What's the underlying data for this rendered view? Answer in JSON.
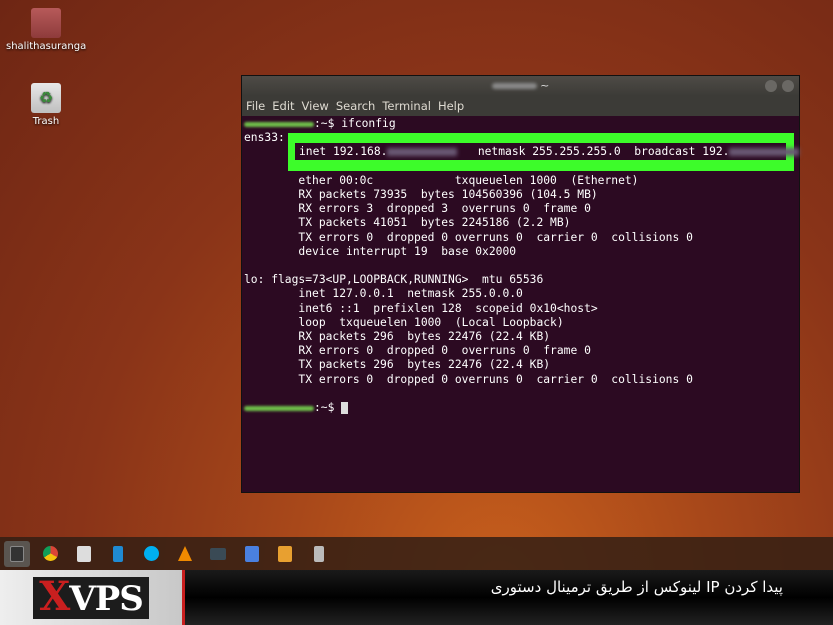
{
  "desktop": {
    "icons": [
      {
        "label": "shalithasuranga",
        "icon": "home-folder-icon"
      },
      {
        "label": "Trash",
        "icon": "trash-icon"
      }
    ]
  },
  "terminal": {
    "title_suffix": "~",
    "menu": [
      "File",
      "Edit",
      "View",
      "Search",
      "Terminal",
      "Help"
    ],
    "prompt_suffix": ":~$ ",
    "command": "ifconfig",
    "iface1": "ens33:",
    "highlight": {
      "inet": "inet 192.168.",
      "netmask": "netmask 255.255.255.0  broadcast 192.",
      "color": "#3dfc2a"
    },
    "lines1": [
      "ether 00:0c            txqueuelen 1000  (Ethernet)",
      "RX packets 73935  bytes 104560396 (104.5 MB)",
      "RX errors 3  dropped 3  overruns 0  frame 0",
      "TX packets 41051  bytes 2245186 (2.2 MB)",
      "TX errors 0  dropped 0 overruns 0  carrier 0  collisions 0",
      "device interrupt 19  base 0x2000"
    ],
    "lo_header": "lo: flags=73<UP,LOOPBACK,RUNNING>  mtu 65536",
    "lines2": [
      "inet 127.0.0.1  netmask 255.0.0.0",
      "inet6 ::1  prefixlen 128  scopeid 0x10<host>",
      "loop  txqueuelen 1000  (Local Loopback)",
      "RX packets 296  bytes 22476 (22.4 KB)",
      "RX errors 0  dropped 0  overruns 0  frame 0",
      "TX packets 296  bytes 22476 (22.4 KB)",
      "TX errors 0  dropped 0 overruns 0  carrier 0  collisions 0"
    ]
  },
  "taskbar": [
    "terminal-icon",
    "chrome-icon",
    "files-icon",
    "vscode-icon",
    "skype-icon",
    "vlc-icon",
    "system-monitor-icon",
    "text-editor-icon",
    "archive-icon",
    "usb-drive-icon"
  ],
  "banner": {
    "logo_x": "X",
    "logo_rest": "VPS",
    "caption": "پیدا کردن IP لینوکس از طریق ترمینال دستوری"
  }
}
